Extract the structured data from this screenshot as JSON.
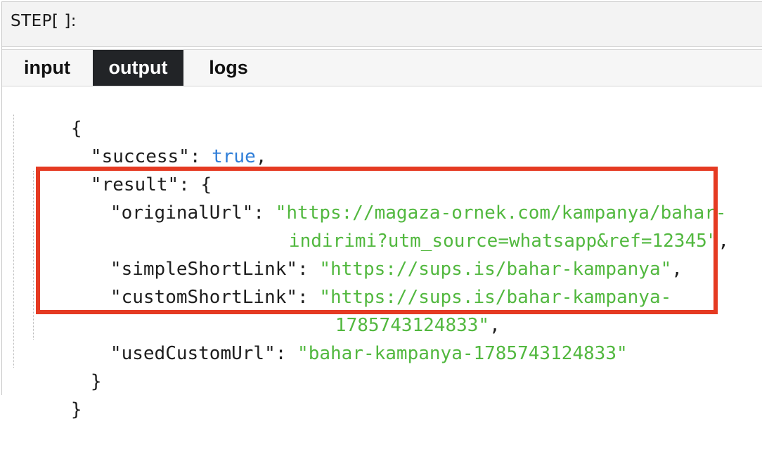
{
  "step": {
    "title": "STEP[ ]:"
  },
  "tabs": [
    {
      "label": "input",
      "active": false
    },
    {
      "label": "output",
      "active": true
    },
    {
      "label": "logs",
      "active": false
    }
  ],
  "json_view": {
    "open_brace": "{",
    "close_brace": "}",
    "success_key": "\"success\"",
    "success_value": "true",
    "result_key": "\"result\"",
    "result_open": "{",
    "result_close": "}",
    "originalUrl_key": "\"originalUrl\"",
    "originalUrl_value_line1": "\"https://magaza-ornek.com/kampanya/bahar-",
    "originalUrl_value_line2": "indirimi?utm_source=whatsapp&ref=12345\"",
    "simpleShortLink_key": "\"simpleShortLink\"",
    "simpleShortLink_value": "\"https://sups.is/bahar-kampanya\"",
    "customShortLink_key": "\"customShortLink\"",
    "customShortLink_value_line1": "\"https://sups.is/bahar-kampanya-",
    "customShortLink_value_line2": "1785743124833\"",
    "usedCustomUrl_key": "\"usedCustomUrl\"",
    "usedCustomUrl_value": "\"bahar-kampanya-1785743124833\"",
    "colon": ": ",
    "comma": ","
  },
  "colors": {
    "string": "#52b83f",
    "boolean": "#2f7ed8",
    "highlight_border": "#e53a22",
    "active_tab_bg": "#222427"
  }
}
